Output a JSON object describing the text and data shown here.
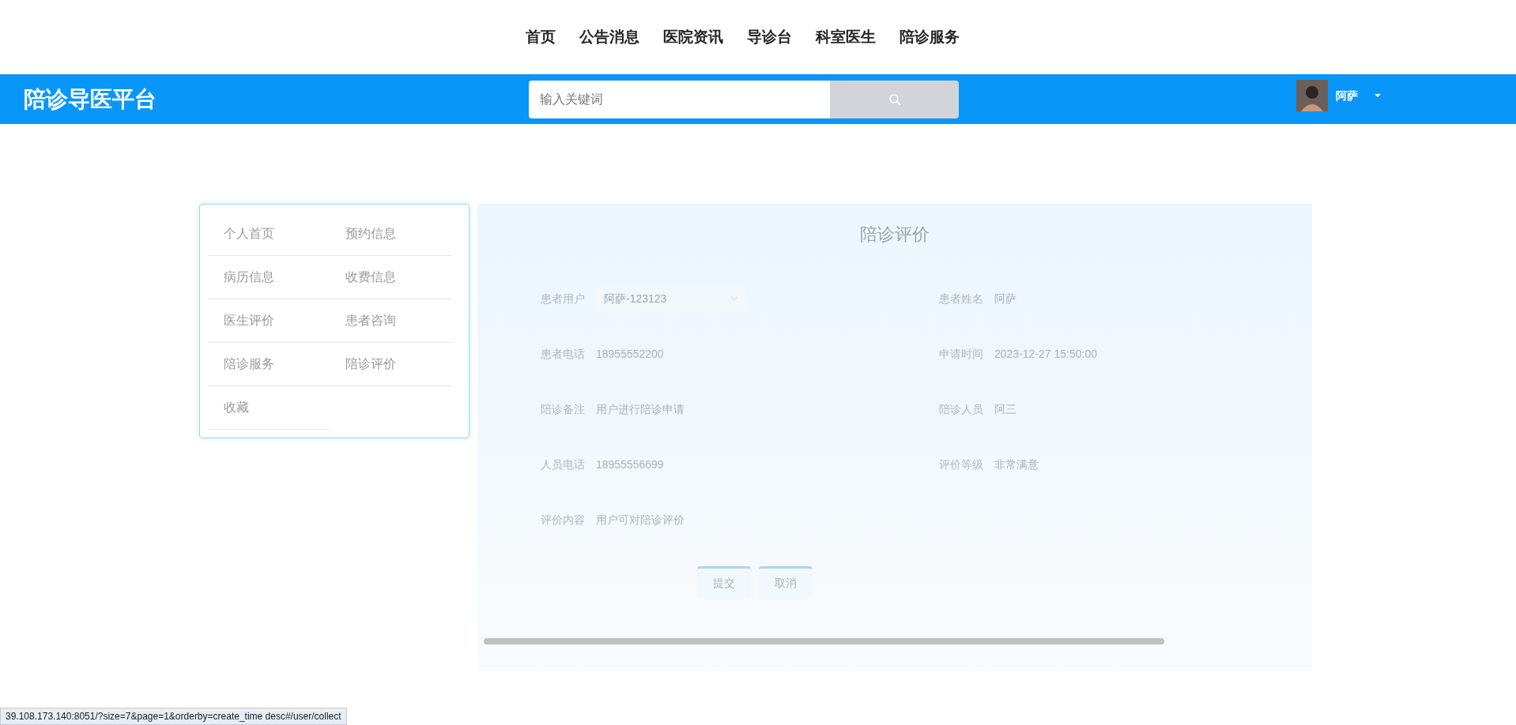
{
  "top_nav": [
    {
      "label": "首页"
    },
    {
      "label": "公告消息"
    },
    {
      "label": "医院资讯"
    },
    {
      "label": "导诊台"
    },
    {
      "label": "科室医生"
    },
    {
      "label": "陪诊服务"
    }
  ],
  "header": {
    "logo": "陪诊导医平台",
    "search": {
      "placeholder": "输入关键词"
    },
    "user": {
      "name": "阿萨"
    }
  },
  "sidebar": {
    "items": [
      {
        "label": "个人首页"
      },
      {
        "label": "预约信息"
      },
      {
        "label": "病历信息"
      },
      {
        "label": "收费信息"
      },
      {
        "label": "医生评价"
      },
      {
        "label": "患者咨询"
      },
      {
        "label": "陪诊服务"
      },
      {
        "label": "陪诊评价"
      },
      {
        "label": "收藏"
      }
    ]
  },
  "form": {
    "title": "陪诊评价",
    "fields": [
      {
        "label": "患者用户",
        "kind": "select",
        "value": "阿萨-123123"
      },
      {
        "label": "患者姓名",
        "kind": "text",
        "value": "阿萨"
      },
      {
        "label": "患者电话",
        "kind": "text",
        "value": "18955552200"
      },
      {
        "label": "申请时间",
        "kind": "text",
        "value": "2023-12-27 15:50:00"
      },
      {
        "label": "陪诊备注",
        "kind": "text",
        "value": "用户进行陪诊申请"
      },
      {
        "label": "陪诊人员",
        "kind": "text",
        "value": "阿三"
      },
      {
        "label": "人员电话",
        "kind": "text",
        "value": "18955556699"
      },
      {
        "label": "评价等级",
        "kind": "text",
        "value": "非常满意"
      },
      {
        "label": "评价内容",
        "kind": "text",
        "value": "用户可对陪诊评价"
      }
    ],
    "buttons": [
      "提交",
      "取消"
    ]
  },
  "status_bar": "39.108.173.140:8051/?size=7&page=1&orderby=create_time desc#/user/collect"
}
